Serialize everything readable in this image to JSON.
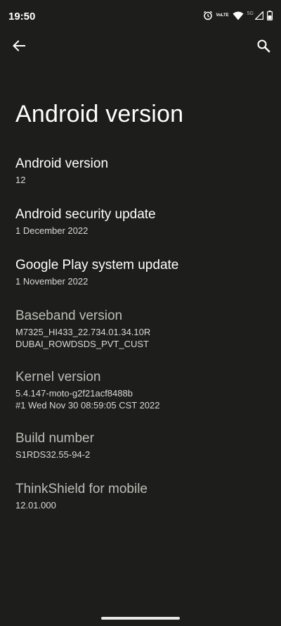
{
  "status_bar": {
    "time": "19:50",
    "lte_top": "VoLTE",
    "network": "5G",
    "icons": [
      "alarm-icon",
      "volte-icon",
      "wifi-icon",
      "signal-icon",
      "battery-icon"
    ]
  },
  "toolbar": {
    "back_icon": "arrow-left-icon",
    "search_icon": "search-icon"
  },
  "page": {
    "title": "Android version"
  },
  "items": [
    {
      "title": "Android version",
      "value": "12"
    },
    {
      "title": "Android security update",
      "value": "1 December 2022"
    },
    {
      "title": "Google Play system update",
      "value": "1 November 2022"
    },
    {
      "title": "Baseband version",
      "value": "M7325_HI433_22.734.01.34.10R",
      "value2": "DUBAI_ROWDSDS_PVT_CUST"
    },
    {
      "title": "Kernel version",
      "value": "5.4.147-moto-g2f21acf8488b",
      "value2": "#1 Wed Nov 30 08:59:05 CST 2022"
    },
    {
      "title": "Build number",
      "value": "S1RDS32.55-94-2"
    },
    {
      "title": "ThinkShield for mobile",
      "value": "12.01.000"
    }
  ],
  "colors": {
    "background": "#1d1d1b",
    "primary_text": "#ffffff",
    "secondary_text": "#d9d9d6",
    "dim_title": "#bdbdb8"
  }
}
